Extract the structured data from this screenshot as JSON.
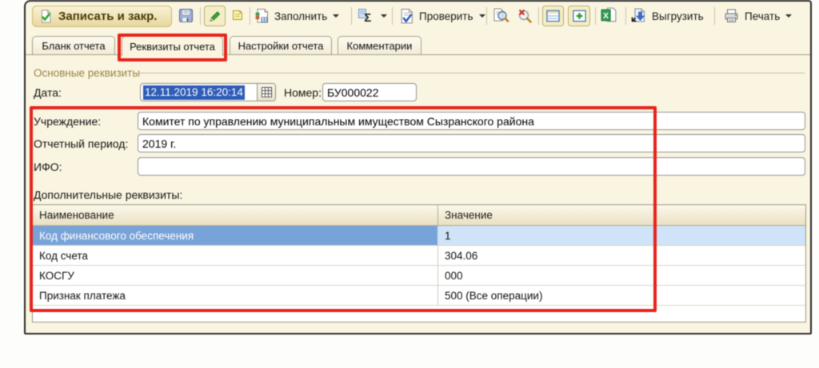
{
  "toolbar": {
    "save_close_label": "Записать и закр.",
    "fill_label": "Заполнить",
    "check_label": "Проверить",
    "export_label": "Выгрузить",
    "print_label": "Печать"
  },
  "tabs": [
    {
      "label": "Бланк отчета",
      "active": false
    },
    {
      "label": "Реквизиты отчета",
      "active": true
    },
    {
      "label": "Настройки отчета",
      "active": false
    },
    {
      "label": "Комментарии",
      "active": false
    }
  ],
  "form": {
    "group_title": "Основные реквизиты",
    "date_label": "Дата:",
    "date_value": "12.11.2019 16:20:14",
    "number_label": "Номер:",
    "number_value": "БУ000022",
    "institution_label": "Учреждение:",
    "institution_value": "Комитет по управлению муниципальным имуществом Сызранского района",
    "period_label": "Отчетный период:",
    "period_value": "2019 г.",
    "ifo_label": "ИФО:",
    "ifo_value": "",
    "additional_label": "Дополнительные реквизиты:"
  },
  "table": {
    "columns": [
      "Наименование",
      "Значение"
    ],
    "rows": [
      {
        "name": "Код финансового обеспечения",
        "value": "1",
        "selected": true
      },
      {
        "name": "Код счета",
        "value": "304.06",
        "selected": false
      },
      {
        "name": "КОСГУ",
        "value": "000",
        "selected": false
      },
      {
        "name": "Признак платежа",
        "value": "500 (Все операции)",
        "selected": false
      }
    ]
  },
  "icons": {
    "save_close": "document-with-green-check",
    "save": "floppy-disk",
    "edit": "green-pencil",
    "copy_note": "yellow-note",
    "fill": "document-with-colored-table",
    "sum": "sigma",
    "check": "document-with-blue-check",
    "find": "magnifier-over-document",
    "clear_find": "magnifier-with-red-x",
    "table_view": "table-grid",
    "table_add": "table-with-green-plus",
    "excel": "excel-sheet",
    "export": "document-with-blue-arrow",
    "print": "printer",
    "calendar": "calendar-grid"
  },
  "colors": {
    "annotation_red": "#e6231c",
    "window_bg": "#faf5e1",
    "selection_blue": "#2f5cb8",
    "selected_row_name_bg": "#78a3d8",
    "selected_row_value_bg": "#cfe4f8"
  }
}
